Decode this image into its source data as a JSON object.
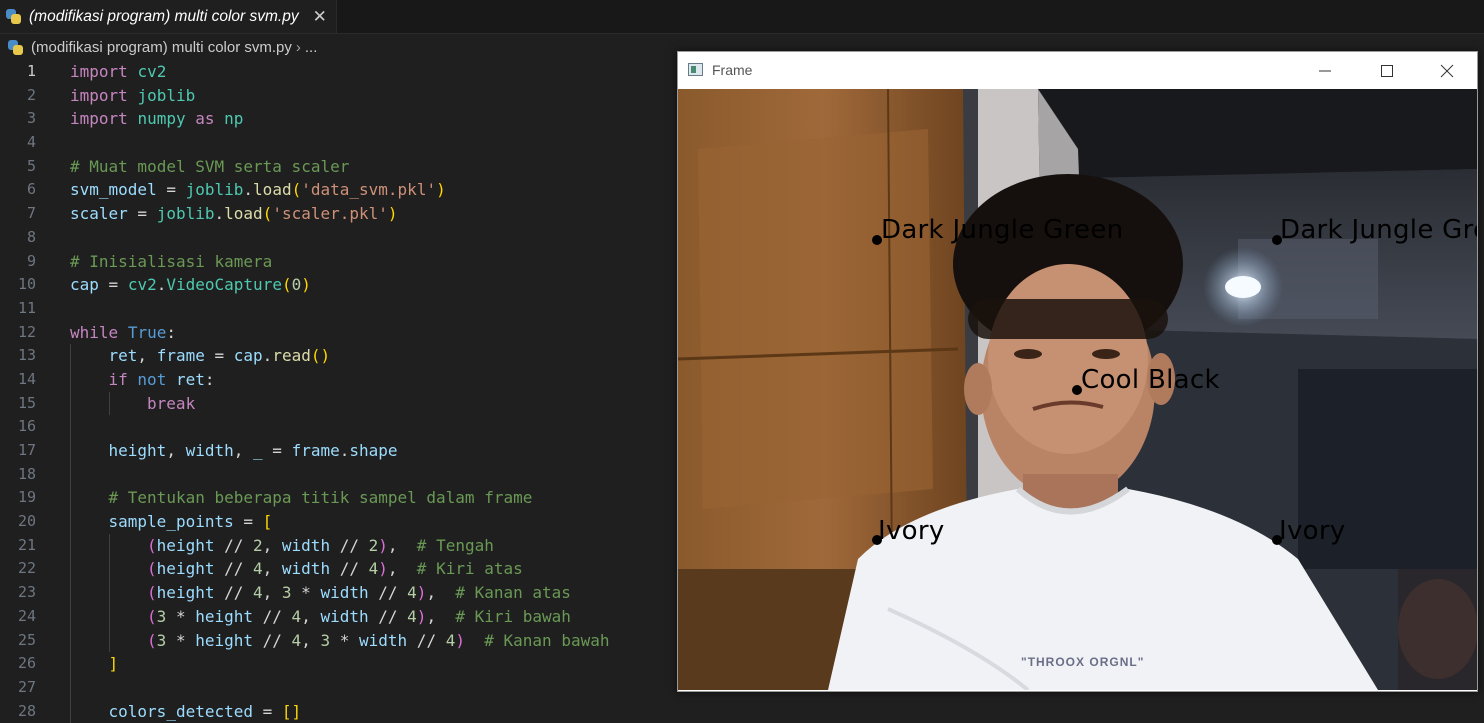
{
  "editor": {
    "tab": {
      "title": "(modifikasi program) multi color svm.py",
      "close_symbol": "✕"
    },
    "breadcrumb": {
      "file": "(modifikasi program) multi color svm.py",
      "separator": "›",
      "more": "..."
    },
    "active_line": "1",
    "lines": [
      {
        "n": "1",
        "indent": 0,
        "tokens": [
          [
            "kw",
            "import"
          ],
          [
            "op",
            " "
          ],
          [
            "mod",
            "cv2"
          ]
        ]
      },
      {
        "n": "2",
        "indent": 0,
        "tokens": [
          [
            "kw",
            "import"
          ],
          [
            "op",
            " "
          ],
          [
            "mod",
            "joblib"
          ]
        ]
      },
      {
        "n": "3",
        "indent": 0,
        "tokens": [
          [
            "kw",
            "import"
          ],
          [
            "op",
            " "
          ],
          [
            "mod",
            "numpy"
          ],
          [
            "op",
            " "
          ],
          [
            "kw",
            "as"
          ],
          [
            "op",
            " "
          ],
          [
            "mod",
            "np"
          ]
        ]
      },
      {
        "n": "4",
        "indent": 0,
        "tokens": []
      },
      {
        "n": "5",
        "indent": 0,
        "tokens": [
          [
            "cm",
            "# Muat model SVM serta scaler"
          ]
        ]
      },
      {
        "n": "6",
        "indent": 0,
        "tokens": [
          [
            "var",
            "svm_model"
          ],
          [
            "op",
            " = "
          ],
          [
            "mod",
            "joblib"
          ],
          [
            "op",
            "."
          ],
          [
            "fn",
            "load"
          ],
          [
            "p1",
            "("
          ],
          [
            "str",
            "'data_svm.pkl'"
          ],
          [
            "p1",
            ")"
          ]
        ]
      },
      {
        "n": "7",
        "indent": 0,
        "tokens": [
          [
            "var",
            "scaler"
          ],
          [
            "op",
            " = "
          ],
          [
            "mod",
            "joblib"
          ],
          [
            "op",
            "."
          ],
          [
            "fn",
            "load"
          ],
          [
            "p1",
            "("
          ],
          [
            "str",
            "'scaler.pkl'"
          ],
          [
            "p1",
            ")"
          ]
        ]
      },
      {
        "n": "8",
        "indent": 0,
        "tokens": []
      },
      {
        "n": "9",
        "indent": 0,
        "tokens": [
          [
            "cm",
            "# Inisialisasi kamera"
          ]
        ]
      },
      {
        "n": "10",
        "indent": 0,
        "tokens": [
          [
            "var",
            "cap"
          ],
          [
            "op",
            " = "
          ],
          [
            "mod",
            "cv2"
          ],
          [
            "op",
            "."
          ],
          [
            "mod",
            "VideoCapture"
          ],
          [
            "p1",
            "("
          ],
          [
            "num",
            "0"
          ],
          [
            "p1",
            ")"
          ]
        ]
      },
      {
        "n": "11",
        "indent": 0,
        "tokens": []
      },
      {
        "n": "12",
        "indent": 0,
        "tokens": [
          [
            "kw",
            "while"
          ],
          [
            "op",
            " "
          ],
          [
            "bk",
            "True"
          ],
          [
            "op",
            ":"
          ]
        ]
      },
      {
        "n": "13",
        "indent": 1,
        "tokens": [
          [
            "var",
            "ret"
          ],
          [
            "op",
            ", "
          ],
          [
            "var",
            "frame"
          ],
          [
            "op",
            " = "
          ],
          [
            "var",
            "cap"
          ],
          [
            "op",
            "."
          ],
          [
            "fn",
            "read"
          ],
          [
            "p1",
            "()"
          ]
        ]
      },
      {
        "n": "14",
        "indent": 1,
        "tokens": [
          [
            "kw",
            "if"
          ],
          [
            "op",
            " "
          ],
          [
            "bk",
            "not"
          ],
          [
            "op",
            " "
          ],
          [
            "var",
            "ret"
          ],
          [
            "op",
            ":"
          ]
        ]
      },
      {
        "n": "15",
        "indent": 2,
        "tokens": [
          [
            "kw",
            "break"
          ]
        ]
      },
      {
        "n": "16",
        "indent": 1,
        "tokens": []
      },
      {
        "n": "17",
        "indent": 1,
        "tokens": [
          [
            "var",
            "height"
          ],
          [
            "op",
            ", "
          ],
          [
            "var",
            "width"
          ],
          [
            "op",
            ", "
          ],
          [
            "var",
            "_"
          ],
          [
            "op",
            " = "
          ],
          [
            "var",
            "frame"
          ],
          [
            "op",
            "."
          ],
          [
            "var",
            "shape"
          ]
        ]
      },
      {
        "n": "18",
        "indent": 1,
        "tokens": []
      },
      {
        "n": "19",
        "indent": 1,
        "tokens": [
          [
            "cm",
            "# Tentukan beberapa titik sampel dalam frame"
          ]
        ]
      },
      {
        "n": "20",
        "indent": 1,
        "tokens": [
          [
            "var",
            "sample_points"
          ],
          [
            "op",
            " = "
          ],
          [
            "p1",
            "["
          ]
        ]
      },
      {
        "n": "21",
        "indent": 2,
        "tokens": [
          [
            "p2",
            "("
          ],
          [
            "var",
            "height"
          ],
          [
            "op",
            " // "
          ],
          [
            "num",
            "2"
          ],
          [
            "op",
            ", "
          ],
          [
            "var",
            "width"
          ],
          [
            "op",
            " // "
          ],
          [
            "num",
            "2"
          ],
          [
            "p2",
            ")"
          ],
          [
            "op",
            ",  "
          ],
          [
            "cm",
            "# Tengah"
          ]
        ]
      },
      {
        "n": "22",
        "indent": 2,
        "tokens": [
          [
            "p2",
            "("
          ],
          [
            "var",
            "height"
          ],
          [
            "op",
            " // "
          ],
          [
            "num",
            "4"
          ],
          [
            "op",
            ", "
          ],
          [
            "var",
            "width"
          ],
          [
            "op",
            " // "
          ],
          [
            "num",
            "4"
          ],
          [
            "p2",
            ")"
          ],
          [
            "op",
            ",  "
          ],
          [
            "cm",
            "# Kiri atas"
          ]
        ]
      },
      {
        "n": "23",
        "indent": 2,
        "tokens": [
          [
            "p2",
            "("
          ],
          [
            "var",
            "height"
          ],
          [
            "op",
            " // "
          ],
          [
            "num",
            "4"
          ],
          [
            "op",
            ", "
          ],
          [
            "num",
            "3"
          ],
          [
            "op",
            " * "
          ],
          [
            "var",
            "width"
          ],
          [
            "op",
            " // "
          ],
          [
            "num",
            "4"
          ],
          [
            "p2",
            ")"
          ],
          [
            "op",
            ",  "
          ],
          [
            "cm",
            "# Kanan atas"
          ]
        ]
      },
      {
        "n": "24",
        "indent": 2,
        "tokens": [
          [
            "p2",
            "("
          ],
          [
            "num",
            "3"
          ],
          [
            "op",
            " * "
          ],
          [
            "var",
            "height"
          ],
          [
            "op",
            " // "
          ],
          [
            "num",
            "4"
          ],
          [
            "op",
            ", "
          ],
          [
            "var",
            "width"
          ],
          [
            "op",
            " // "
          ],
          [
            "num",
            "4"
          ],
          [
            "p2",
            ")"
          ],
          [
            "op",
            ",  "
          ],
          [
            "cm",
            "# Kiri bawah"
          ]
        ]
      },
      {
        "n": "25",
        "indent": 2,
        "tokens": [
          [
            "p2",
            "("
          ],
          [
            "num",
            "3"
          ],
          [
            "op",
            " * "
          ],
          [
            "var",
            "height"
          ],
          [
            "op",
            " // "
          ],
          [
            "num",
            "4"
          ],
          [
            "op",
            ", "
          ],
          [
            "num",
            "3"
          ],
          [
            "op",
            " * "
          ],
          [
            "var",
            "width"
          ],
          [
            "op",
            " // "
          ],
          [
            "num",
            "4"
          ],
          [
            "p2",
            ")"
          ],
          [
            "op",
            "  "
          ],
          [
            "cm",
            "# Kanan bawah"
          ]
        ]
      },
      {
        "n": "26",
        "indent": 1,
        "tokens": [
          [
            "p1",
            "]"
          ]
        ]
      },
      {
        "n": "27",
        "indent": 1,
        "tokens": []
      },
      {
        "n": "28",
        "indent": 1,
        "tokens": [
          [
            "var",
            "colors_detected"
          ],
          [
            "op",
            " = "
          ],
          [
            "p1",
            "[]"
          ]
        ]
      }
    ]
  },
  "cv_window": {
    "title": "Frame",
    "labels": {
      "top_left": "Dark Jungle Green",
      "top_right": "Dark Jungle Green",
      "center": "Cool Black",
      "bottom_left": "Ivory",
      "bottom_right": "Ivory"
    },
    "shirt_text": "\"THROOX ORGNL\""
  }
}
